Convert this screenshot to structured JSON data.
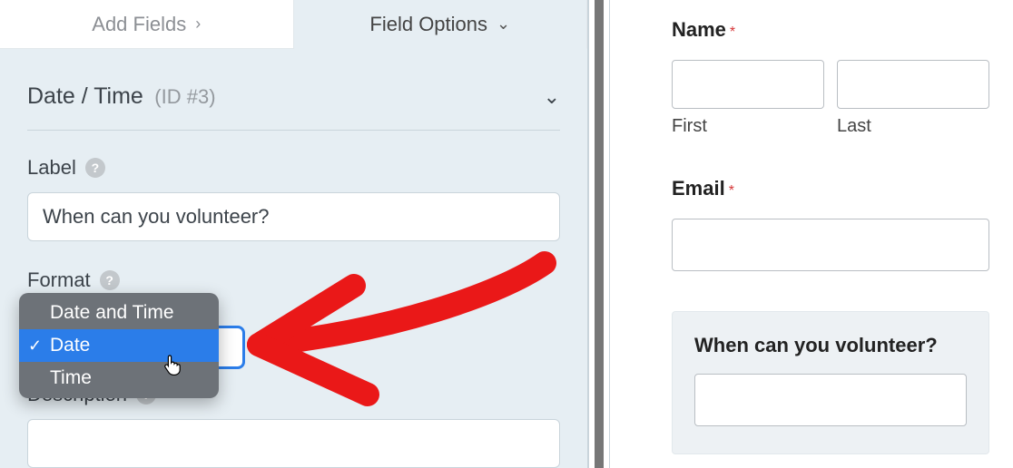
{
  "tabs": {
    "add_fields": "Add Fields",
    "field_options": "Field Options"
  },
  "section": {
    "title": "Date / Time",
    "id_text": "(ID #3)"
  },
  "labels": {
    "label": "Label",
    "format": "Format",
    "description": "Description"
  },
  "inputs": {
    "label_value": "When can you volunteer?"
  },
  "format_options": {
    "date_and_time": "Date and Time",
    "date": "Date",
    "time": "Time"
  },
  "preview": {
    "name_label": "Name",
    "first": "First",
    "last": "Last",
    "email_label": "Email",
    "volunteer_label": "When can you volunteer?",
    "required_mark": "*"
  },
  "icons": {
    "help": "?",
    "chevron_right": "›",
    "chevron_down": "⌄",
    "check": "✓"
  }
}
